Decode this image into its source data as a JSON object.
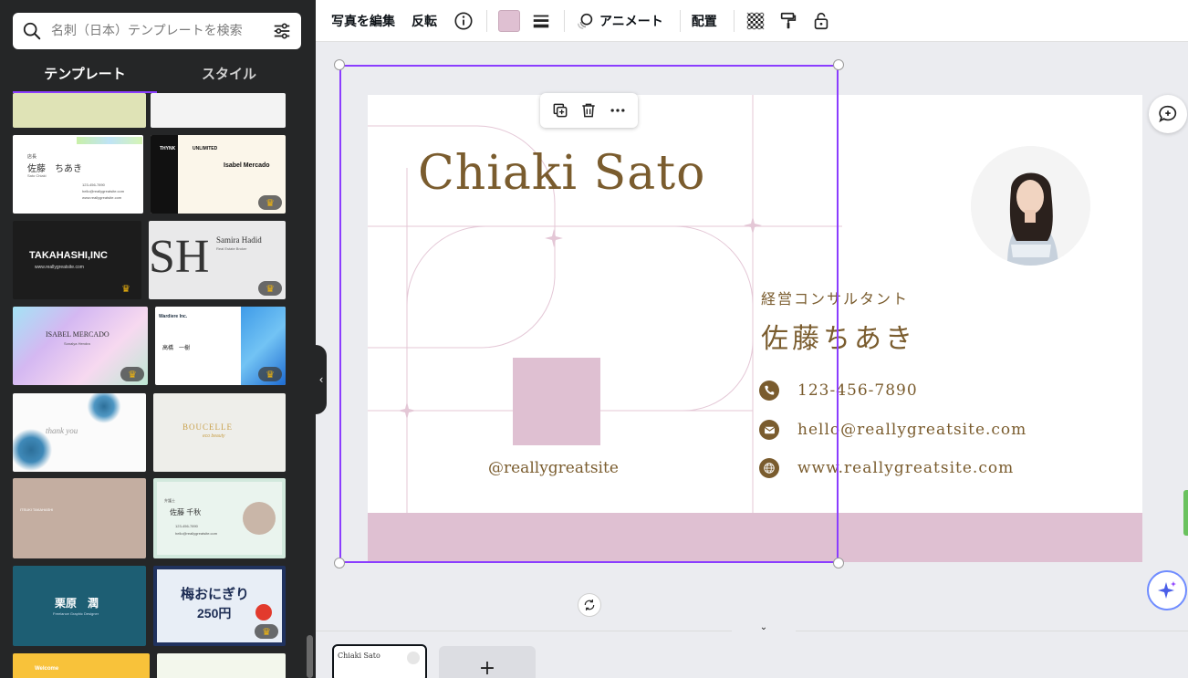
{
  "search": {
    "placeholder": "名刺（日本）テンプレートを検索"
  },
  "panel_tabs": [
    {
      "label": "テンプレート",
      "active": true
    },
    {
      "label": "スタイル",
      "active": false
    }
  ],
  "templates": [
    {
      "title": "",
      "lines": [
        ""
      ]
    },
    {
      "title": "佐藤　ちあき",
      "sub": "Sato Chiaki",
      "lines": [
        "123-456-7890",
        "hello@reallygreatsite.com",
        "www.reallygreatsite.com"
      ],
      "role": "店長"
    },
    {
      "title": "Isabel Mercado",
      "brand": "THYNK",
      "brand2": "UNLIMITED",
      "premium": true
    },
    {
      "title": "TAKAHASHI,INC",
      "sub": "www.reallygreatsite.com",
      "premium": true
    },
    {
      "title": "Samira Hadid",
      "sub": "Real Estate Broker",
      "mono": "SH",
      "premium": true
    },
    {
      "title": "ISABEL MERCADO",
      "sub": "Sonalya Hendra",
      "premium": true
    },
    {
      "title": "高橋　一樹",
      "brand": "Wardiere Inc.",
      "premium": true
    },
    {
      "title": "thank you"
    },
    {
      "title": "BOUCELLE",
      "sub": "eco beauty"
    },
    {
      "title": "ITSUKI TAKAHASHI"
    },
    {
      "title": "佐藤 千秋",
      "role": "弁護士",
      "lines": [
        "123-456-7890",
        "hello@reallygreatsite.com"
      ]
    },
    {
      "title": "栗原　潤",
      "sub": "Freelance Graphic Designer"
    },
    {
      "title": "梅おにぎり",
      "sub": "250円",
      "premium": true
    },
    {
      "title": "Welcome"
    },
    {
      "title": ""
    }
  ],
  "toolbar": {
    "edit_photo": "写真を編集",
    "flip": "反転",
    "animate": "アニメート",
    "position": "配置",
    "swatch_color": "#dfc0d2"
  },
  "card": {
    "name": "Chiaki Sato",
    "role": "経営コンサルタント",
    "jp_name": "佐藤ちあき",
    "phone": "123-456-7890",
    "email": "hello@reallygreatsite.com",
    "website": "www.reallygreatsite.com",
    "handle": "@reallygreatsite",
    "accent": "#7a5c2e",
    "pink": "#dfc0d2"
  },
  "pages": {
    "thumb_title": "Chiaki Sato",
    "add_label": "+"
  }
}
